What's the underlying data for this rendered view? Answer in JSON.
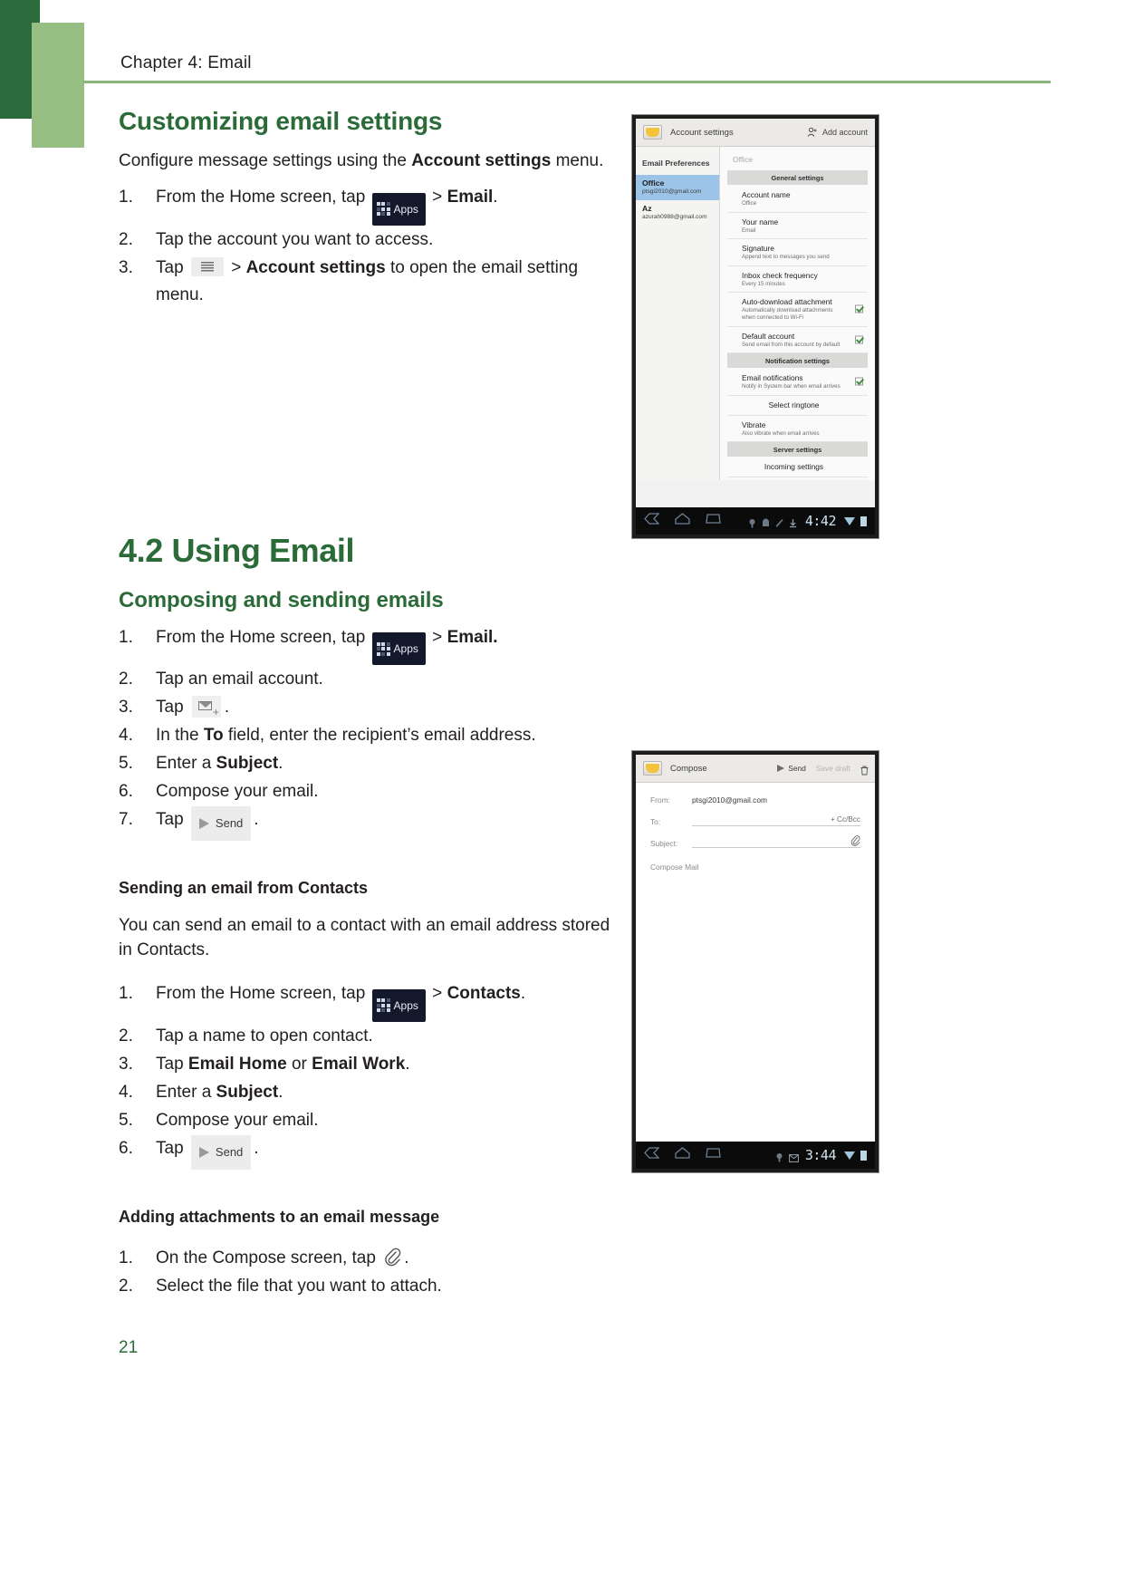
{
  "header": {
    "chapter": "Chapter 4: Email"
  },
  "page_number": "21",
  "sections": {
    "customizing": {
      "title": "Customizing email settings",
      "intro_a": "Configure message settings using the ",
      "intro_b": "Account settings",
      "intro_c": " menu.",
      "steps": [
        {
          "pre": "From the Home screen, tap ",
          "icon": "apps-chip",
          "mid": " > ",
          "bold": "Email",
          "post": "."
        },
        {
          "pre": "Tap the account you want to access.",
          "icon": "",
          "mid": "",
          "bold": "",
          "post": ""
        },
        {
          "pre": "Tap ",
          "icon": "menu-chip",
          "mid": " > ",
          "bold": "Account settings",
          "post": " to open the email setting menu."
        }
      ]
    },
    "using_email": {
      "title": "4.2 Using Email"
    },
    "composing": {
      "title": "Composing and sending emails",
      "steps": [
        {
          "text_pre": "From the Home screen, tap ",
          "text_post": " > ",
          "bold": "Email.",
          "tail": ""
        },
        {
          "text_pre": "Tap an email account.",
          "text_post": "",
          "bold": "",
          "tail": ""
        },
        {
          "text_pre": "Tap ",
          "text_post": "",
          "bold": "",
          "tail": "."
        },
        {
          "text_pre": "In the ",
          "text_post": " field, enter the recipient’s email address.",
          "bold": "To",
          "tail": ""
        },
        {
          "text_pre": "Enter a ",
          "text_post": ".",
          "bold": "Subject",
          "tail": ""
        },
        {
          "text_pre": "Compose your email.",
          "text_post": "",
          "bold": "",
          "tail": ""
        },
        {
          "text_pre": "Tap ",
          "text_post": "",
          "bold": "",
          "tail": "."
        }
      ]
    },
    "contacts": {
      "title": "Sending an email from Contacts",
      "intro": "You can send an email to a contact with an email address stored in Contacts.",
      "steps": [
        {
          "pre": "From the Home screen, tap ",
          "mid": " > ",
          "bold": "Contacts",
          "post": "."
        },
        {
          "pre": "Tap a name to open contact.",
          "mid": "",
          "bold": "",
          "post": ""
        },
        {
          "pre": "Tap ",
          "mid": " or ",
          "bold": "Email Home",
          "bold2": "Email Work",
          "post": "."
        },
        {
          "pre": "Enter a ",
          "mid": "",
          "bold": "Subject",
          "post": "."
        },
        {
          "pre": "Compose your email.",
          "mid": "",
          "bold": "",
          "post": ""
        },
        {
          "pre": "Tap ",
          "mid": "",
          "bold": "",
          "post": "."
        }
      ]
    },
    "attachments": {
      "title": "Adding attachments to an email message",
      "steps": [
        {
          "pre": "On the Compose screen, tap ",
          "post": "."
        },
        {
          "pre": "Select the file that you want to attach.",
          "post": ""
        }
      ]
    }
  },
  "chips": {
    "apps_label": "Apps",
    "send_label": "Send"
  },
  "screenshot_settings": {
    "title": "Account settings",
    "add_account": "Add account",
    "left_header": "Email Preferences",
    "accounts": [
      {
        "name": "Office",
        "email": "ptsgi2010@gmail.com",
        "selected": true
      },
      {
        "name": "Az",
        "email": "azurah0988@gmail.com",
        "selected": false
      }
    ],
    "breadcrumb": "Office",
    "groups": [
      {
        "band": "General settings",
        "options": [
          {
            "title": "Account name",
            "subtitle": "Office",
            "checkbox": false,
            "checked": false,
            "centered": false
          },
          {
            "title": "Your name",
            "subtitle": "Email",
            "checkbox": false,
            "checked": false,
            "centered": false
          },
          {
            "title": "Signature",
            "subtitle": "Append text to messages you send",
            "checkbox": false,
            "checked": false,
            "centered": false
          },
          {
            "title": "Inbox check frequency",
            "subtitle": "Every 15 minutes",
            "checkbox": false,
            "checked": false,
            "centered": false
          },
          {
            "title": "Auto-download attachment",
            "subtitle": "Automatically download attachments when connected to Wi-Fi",
            "checkbox": true,
            "checked": true,
            "centered": false
          },
          {
            "title": "Default account",
            "subtitle": "Send email from this account by default",
            "checkbox": true,
            "checked": true,
            "centered": false
          }
        ]
      },
      {
        "band": "Notification settings",
        "options": [
          {
            "title": "Email notifications",
            "subtitle": "Notify in System bar when email arrives",
            "checkbox": true,
            "checked": true,
            "centered": false
          },
          {
            "title": "Select ringtone",
            "subtitle": "",
            "checkbox": false,
            "checked": false,
            "centered": true
          },
          {
            "title": "Vibrate",
            "subtitle": "Also vibrate when email arrives",
            "checkbox": false,
            "checked": false,
            "centered": false
          }
        ]
      },
      {
        "band": "Server settings",
        "options": [
          {
            "title": "Incoming settings",
            "subtitle": "",
            "checkbox": false,
            "checked": false,
            "centered": true
          }
        ]
      }
    ],
    "nav": {
      "clock": "4:42"
    }
  },
  "screenshot_compose": {
    "title": "Compose",
    "send_label": "Send",
    "save_draft_label": "Save draft",
    "fields": [
      {
        "label": "From:",
        "value": "ptsgi2010@gmail.com"
      },
      {
        "label": "To:",
        "value": ""
      },
      {
        "label": "Subject:",
        "value": ""
      }
    ],
    "cc_bcc": "+ Cc/Bcc",
    "body_placeholder": "Compose Mail",
    "nav": {
      "clock": "3:44"
    }
  }
}
